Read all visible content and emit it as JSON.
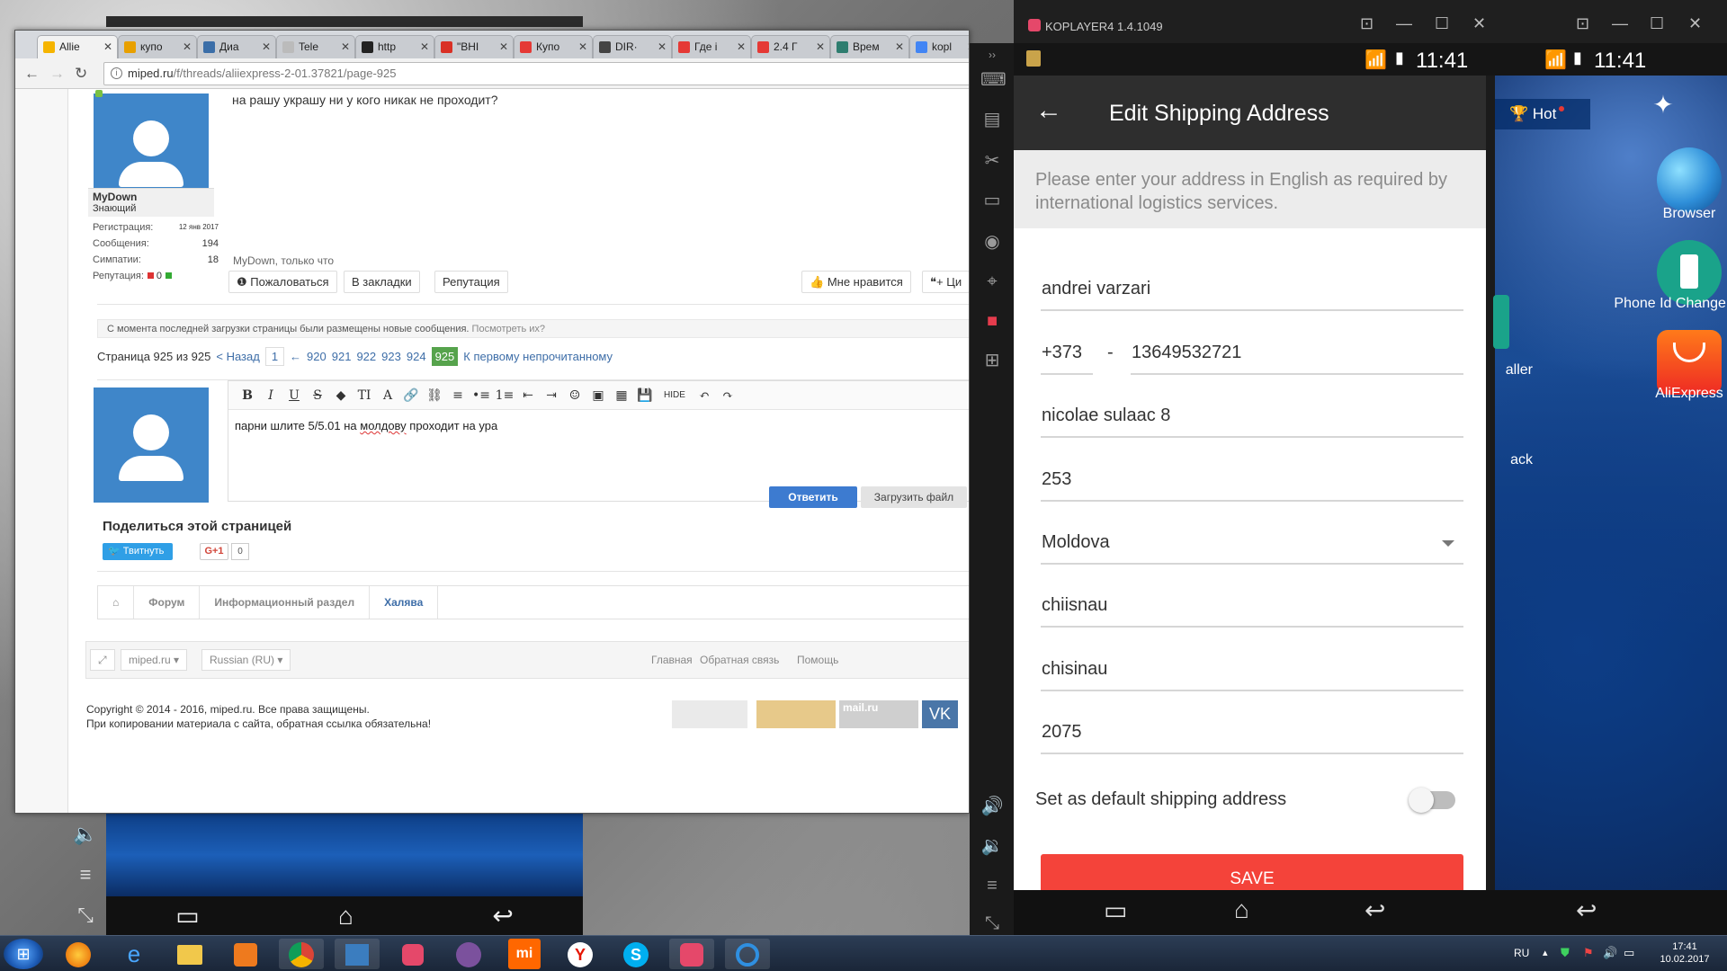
{
  "browser": {
    "tabs": [
      {
        "label": "Allie",
        "color": "#f5b400",
        "active": true
      },
      {
        "label": "купо",
        "color": "#e8a000"
      },
      {
        "label": "Диа",
        "color": "#3b6ea8"
      },
      {
        "label": "Tele",
        "color": "#888888"
      },
      {
        "label": "http",
        "color": "#222222"
      },
      {
        "label": "\"ВНІ",
        "color": "#d93025"
      },
      {
        "label": "Купо",
        "color": "#e53935"
      },
      {
        "label": "DIR·",
        "color": "#444444"
      },
      {
        "label": "Где і",
        "color": "#e53935"
      },
      {
        "label": "2.4 Г",
        "color": "#e53935"
      },
      {
        "label": "Врем",
        "color": "#2e7d6f"
      },
      {
        "label": "kopl",
        "color": "#4285f4"
      }
    ],
    "url_host": "miped.ru",
    "url_path": "/f/threads/aliiexpress-2-01.37821/page-925"
  },
  "post": {
    "text": "на рашу украшу ни у кого никак не проходит?",
    "signature": "MyDown, только что",
    "user": {
      "name": "MyDown",
      "title": "Знающий",
      "stats": [
        {
          "label": "Регистрация:",
          "value": "12 янв 2017"
        },
        {
          "label": "Сообщения:",
          "value": "194"
        },
        {
          "label": "Симпатии:",
          "value": "18"
        },
        {
          "label": "Репутация:",
          "value": "0"
        }
      ]
    },
    "actions": {
      "report": "Пожаловаться",
      "bookmark": "В закладки",
      "reputation": "Репутация",
      "like": "Мне нравится",
      "quote": "+ Ци"
    }
  },
  "notice": {
    "text": "С момента последней загрузки страницы были размещены новые сообщения.",
    "link": "Посмотреть их?"
  },
  "pager": {
    "label": "Страница 925 из 925",
    "prev": "< Назад",
    "first": "1",
    "ellipsis": "←",
    "pages": [
      "920",
      "921",
      "922",
      "923",
      "924"
    ],
    "current": "925",
    "unread": "К первому непрочитанному"
  },
  "editor": {
    "toolbar": [
      "B",
      "I",
      "U",
      "S",
      "◆",
      "TI",
      "A",
      "🔗",
      "⛓",
      "≡",
      "•≡",
      "1≡",
      "⇤",
      "⇥",
      "☺",
      "▣",
      "▦",
      "💾",
      "HIDE",
      "↶",
      "↷"
    ],
    "text_before": "парни шлите 5/5.01   на ",
    "text_underlined": "молдову",
    "text_after": "  проходит на ура",
    "reply": "Ответить",
    "upload": "Загрузить файл"
  },
  "share": {
    "title": "Поделиться этой страницей",
    "tweet": "Твитнуть",
    "gplus": "G+1",
    "gplus_count": "0"
  },
  "breadcrumbs": [
    "Форум",
    "Информационный раздел",
    "Халява"
  ],
  "footer": {
    "site_select": "miped.ru",
    "lang_select": "Russian (RU)",
    "links": [
      "Главная",
      "Обратная связь",
      "Помощь"
    ],
    "copyright_1": "Copyright © 2014 - 2016, miped.ru. Все права защищены.",
    "copyright_2": "При копировании материала с сайта, обратная ссылка обязательна!",
    "badge_vk": "VK",
    "badge_mailru": "mail.ru"
  },
  "koplayer": {
    "title": "KOPLAYER4 1.4.1049",
    "time": "11:41"
  },
  "app": {
    "header_title": "Edit Shipping Address",
    "notice": "Please enter your address in English as required by international logistics services.",
    "fields": {
      "name": "andrei varzari",
      "phone_code": "+373",
      "phone_sep": "-",
      "phone": "13649532721",
      "street": "nicolae sulaac 8",
      "apt": "253",
      "country": "Moldova",
      "state": "chiisnau",
      "city": "chisinau",
      "zip": "2075"
    },
    "default_label": "Set as default shipping address",
    "default_on": false,
    "save": "SAVE"
  },
  "home": {
    "hot": "Hot",
    "icons": [
      {
        "label": "Browser"
      },
      {
        "label": "Phone Id Changer Free"
      },
      {
        "label": "AliExpress"
      }
    ],
    "partial_labels": [
      "aller",
      "ack"
    ]
  },
  "taskbar": {
    "lang": "RU",
    "time": "17:41",
    "date": "10.02.2017"
  }
}
